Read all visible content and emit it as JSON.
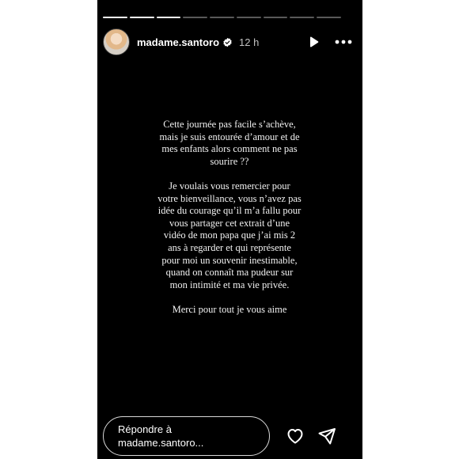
{
  "story": {
    "progress": {
      "total_segments": 9,
      "completed_segments": 3
    }
  },
  "header": {
    "username": "madame.santoro",
    "verified": true,
    "time": "12 h",
    "play_icon": "play-icon",
    "more_icon": "more-horizontal-icon"
  },
  "caption": {
    "paragraphs": [
      [
        "Cette journée pas facile s’achève,",
        "mais je suis entourée d’amour et de",
        "mes enfants alors comment ne pas",
        "sourire ??"
      ],
      [
        "Je voulais vous remercier  pour",
        "votre bienveillance, vous n’avez pas",
        "idée du courage qu’il m’a fallu pour",
        "vous partager cet extrait d’une",
        "vidéo de mon papa que j’ai mis 2",
        "ans à regarder et qui représente",
        "pour moi un souvenir inestimable,",
        "quand on connaît ma pudeur sur",
        "mon intimité et ma vie privée."
      ],
      [
        "Merci pour tout je vous aime"
      ]
    ]
  },
  "footer": {
    "reply_placeholder_line1": "Répondre à",
    "reply_placeholder_line2": "madame.santoro...",
    "like_icon": "heart-icon",
    "share_icon": "send-icon"
  },
  "colors": {
    "background": "#000000",
    "text": "#ffffff",
    "progress_done": "#ffffff",
    "progress_remaining": "rgba(255,255,255,0.35)",
    "verified_badge": "#ffffff"
  }
}
